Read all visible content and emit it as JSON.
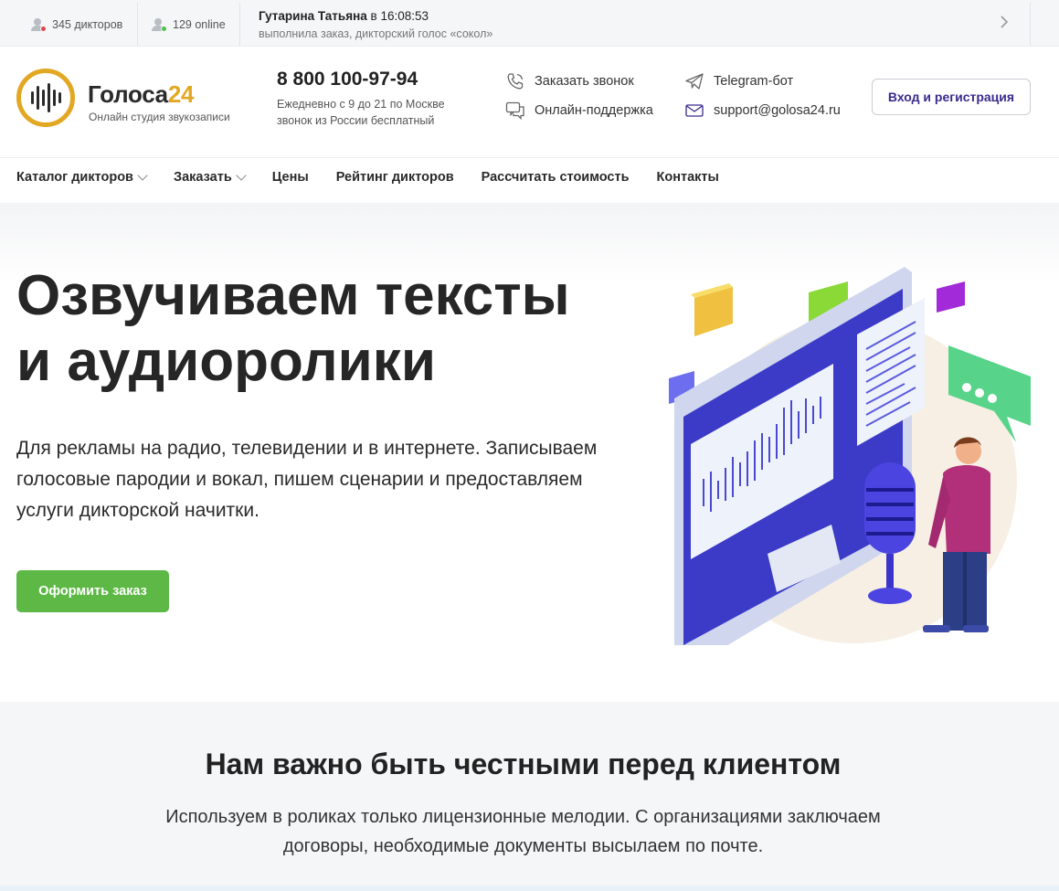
{
  "topbar": {
    "speakers_count": "345 дикторов",
    "online_count": "129 online",
    "ticker_name": "Гутарина Татьяна",
    "ticker_in": " в ",
    "ticker_time": "16:08:53",
    "ticker_action": "выполнила заказ, дикторский голос «сокол»"
  },
  "header": {
    "logo_name": "Голоса",
    "logo_number": "24",
    "logo_tagline": "Онлайн студия звукозаписи",
    "phone": "8 800 100-97-94",
    "phone_hours": "Ежедневно с 9 до 21 по Москве звонок из России бесплатный",
    "callback_label": "Заказать звонок",
    "support_label": "Онлайн-поддержка",
    "telegram_label": "Telegram-бот",
    "email_label": "support@golosa24.ru",
    "login_label": "Вход и регистрация"
  },
  "nav": {
    "items": [
      {
        "label": "Каталог дикторов",
        "dropdown": true
      },
      {
        "label": "Заказать",
        "dropdown": true
      },
      {
        "label": "Цены",
        "dropdown": false
      },
      {
        "label": "Рейтинг дикторов",
        "dropdown": false
      },
      {
        "label": "Рассчитать стоимость",
        "dropdown": false
      },
      {
        "label": "Контакты",
        "dropdown": false
      }
    ]
  },
  "hero": {
    "title_line1": "Озвучиваем тексты",
    "title_line2": "и аудиоролики",
    "text": "Для рекламы на радио, телевидении и в интернете. Записываем голосовые пародии и вокал, пишем сценарии и предоставляем услуги дикторской начитки.",
    "cta_label": "Оформить заказ"
  },
  "honesty": {
    "title": "Нам важно быть честными перед клиентом",
    "text": "Используем в роликах только лицензионные мелодии. С организациями заключаем договоры, необходимые документы высылаем по почте."
  },
  "colors": {
    "brand_gold": "#e2a823",
    "cta_green": "#5db845",
    "login_text": "#3b2a8c",
    "speakers_dot": "#e0484b",
    "online_dot": "#4cc24f"
  },
  "icons": {
    "speakers": "user-icon",
    "online": "user-online-icon",
    "ticker_next": "chevron-right-icon",
    "callback": "phone-icon",
    "support": "chat-icon",
    "telegram": "send-icon",
    "email": "mail-icon"
  }
}
